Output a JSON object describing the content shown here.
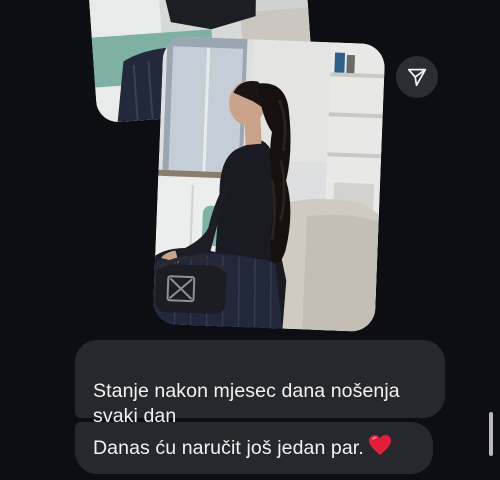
{
  "conversation": {
    "messages": [
      {
        "type": "text",
        "text": "Stanje nakon mjesec dana nošenja\nsvaki dan"
      },
      {
        "type": "text",
        "text": "Danas ću naručit još jedan par.",
        "emoji": "heart-emoji"
      }
    ]
  },
  "icons": {
    "share": "paper-plane-icon",
    "emoji": "red-heart-icon"
  },
  "colors": {
    "background": "#0c0e14",
    "bubble": "#26282d",
    "text": "#f2f2f2",
    "share_button_bg": "#2a2d33",
    "heart": "#e0203a"
  }
}
